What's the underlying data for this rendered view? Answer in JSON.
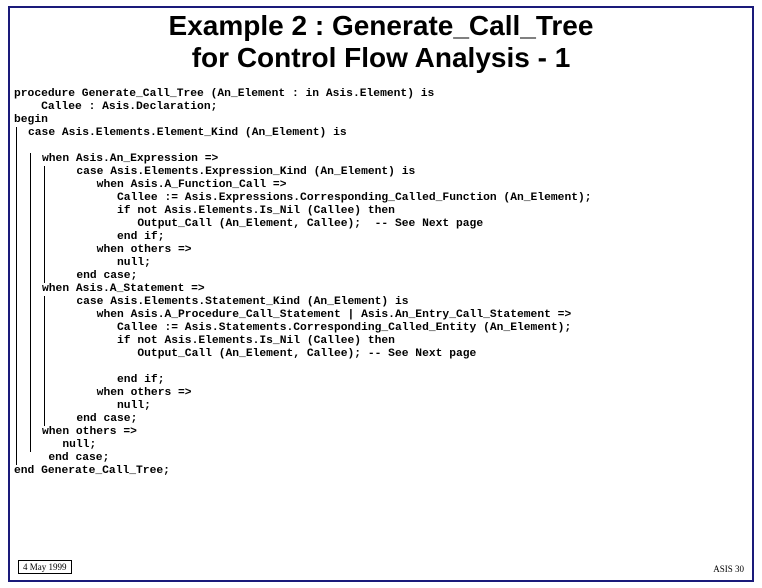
{
  "title_line1": "Example 2 : Generate_Call_Tree",
  "title_line2": "for Control Flow Analysis - 1",
  "code": {
    "l1": "procedure Generate_Call_Tree (An_Element : in Asis.Element) is",
    "l2": "    Callee : Asis.Declaration;",
    "l3": "begin",
    "l4": "case Asis.Elements.Element_Kind (An_Element) is",
    "l5": "",
    "l6": "when Asis.An_Expression =>",
    "l7": "   case Asis.Elements.Expression_Kind (An_Element) is",
    "l8": "      when Asis.A_Function_Call =>",
    "l9": "         Callee := Asis.Expressions.Corresponding_Called_Function (An_Element);",
    "l10": "         if not Asis.Elements.Is_Nil (Callee) then",
    "l11": "            Output_Call (An_Element, Callee);  -- See Next page",
    "l12": "         end if;",
    "l13": "      when others =>",
    "l14": "         null;",
    "l15": "   end case;",
    "l16": "when Asis.A_Statement =>",
    "l17": "   case Asis.Elements.Statement_Kind (An_Element) is",
    "l18": "      when Asis.A_Procedure_Call_Statement | Asis.An_Entry_Call_Statement =>",
    "l19": "         Callee := Asis.Statements.Corresponding_Called_Entity (An_Element);",
    "l20": "         if not Asis.Elements.Is_Nil (Callee) then",
    "l21": "            Output_Call (An_Element, Callee); -- See Next page",
    "l22": "",
    "l23": "         end if;",
    "l24": "      when others =>",
    "l25": "         null;",
    "l26": "   end case;",
    "l27": "when others =>",
    "l28": "   null;",
    "l29": "   end case;",
    "l30": "end Generate_Call_Tree;"
  },
  "footer": {
    "date": "4 May 1999",
    "page": "ASIS 30"
  }
}
